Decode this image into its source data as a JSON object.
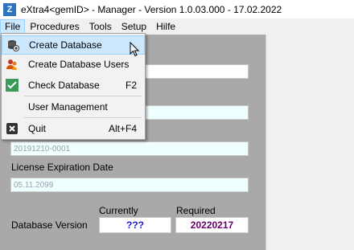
{
  "window": {
    "title": "eXtra4<gemID> - Manager  -  Version 1.0.03.000 - 17.02.2022"
  },
  "menubar": {
    "items": [
      "File",
      "Procedures",
      "Tools",
      "Setup",
      "Hilfe"
    ]
  },
  "file_menu": {
    "items": [
      {
        "label": "Create Database",
        "shortcut": "",
        "icon": "database-add-icon"
      },
      {
        "label": "Create Database Users",
        "shortcut": "",
        "icon": "users-icon"
      },
      {
        "label": "Check Database",
        "shortcut": "F2",
        "icon": "checkmark-icon"
      },
      {
        "label": "User Management",
        "shortcut": "",
        "icon": ""
      },
      {
        "label": "Quit",
        "shortcut": "Alt+F4",
        "icon": "close-icon"
      }
    ]
  },
  "form": {
    "license_id_value": "20191210-0001",
    "license_expiration_label": "License Expiration Date",
    "license_expiration_value": "05.11.2099",
    "currently_label": "Currently",
    "required_label": "Required",
    "db_version_label": "Database Version",
    "db_version_current": "???",
    "db_version_required": "20220217"
  },
  "colors": {
    "current_version": "#1a1acc",
    "required_version": "#660066"
  }
}
